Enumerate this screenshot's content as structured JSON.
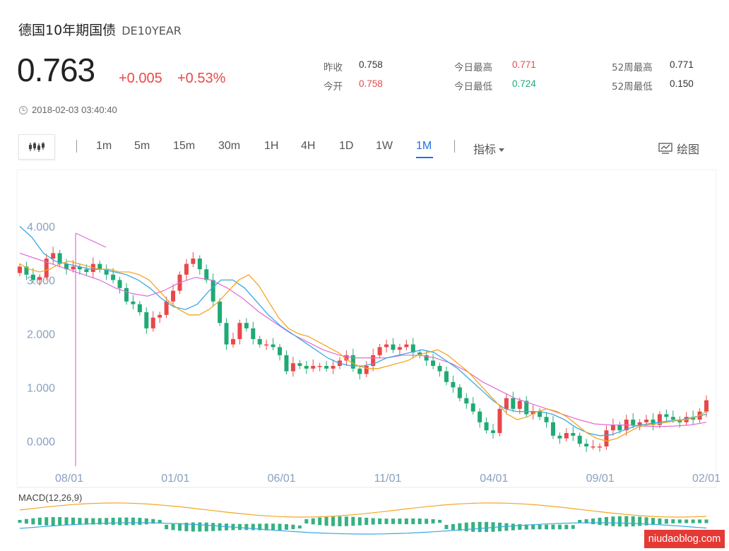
{
  "header": {
    "title": "德国10年期国债",
    "code": "DE10YEAR"
  },
  "quote": {
    "price": "0.763",
    "change": "+0.005",
    "change_pct": "+0.53%",
    "timestamp": "2018-02-03 03:40:40"
  },
  "stats": {
    "prev_close": {
      "label": "昨收",
      "value": "0.758"
    },
    "open": {
      "label": "今开",
      "value": "0.758"
    },
    "day_high": {
      "label": "今日最高",
      "value": "0.771"
    },
    "day_low": {
      "label": "今日最低",
      "value": "0.724"
    },
    "w52_high": {
      "label": "52周最高",
      "value": "0.771"
    },
    "w52_low": {
      "label": "52周最低",
      "value": "0.150"
    }
  },
  "toolbar": {
    "periods": [
      "1m",
      "5m",
      "15m",
      "30m",
      "1H",
      "4H",
      "1D",
      "1W",
      "1M"
    ],
    "active_period": "1M",
    "indicator_label": "指标",
    "draw_label": "绘图"
  },
  "colors": {
    "up": "#e8484a",
    "down": "#1faa74",
    "accent": "#1a73e8",
    "ma_orange": "#f5a623",
    "ma_blue": "#3ca8e0",
    "ma_pink": "#e26bd6"
  },
  "chart_data": {
    "type": "candlestick",
    "y_ticks": [
      "4.000",
      "3.000",
      "2.000",
      "1.000",
      "0.000"
    ],
    "ylim": [
      -0.6,
      4.4
    ],
    "x_ticks": [
      "08/01",
      "01/01",
      "06/01",
      "11/01",
      "04/01",
      "09/01",
      "02/01"
    ],
    "close": [
      3.25,
      3.1,
      3.0,
      3.05,
      3.4,
      3.5,
      3.3,
      3.2,
      3.25,
      3.2,
      3.15,
      3.3,
      3.2,
      3.1,
      3.0,
      2.85,
      2.6,
      2.55,
      2.4,
      2.1,
      2.3,
      2.35,
      2.6,
      2.8,
      3.1,
      3.3,
      3.4,
      3.2,
      3.0,
      2.6,
      2.2,
      1.8,
      1.9,
      2.2,
      2.1,
      1.9,
      1.8,
      1.8,
      1.75,
      1.6,
      1.3,
      1.45,
      1.4,
      1.35,
      1.4,
      1.4,
      1.35,
      1.4,
      1.5,
      1.6,
      1.35,
      1.25,
      1.4,
      1.6,
      1.75,
      1.8,
      1.7,
      1.75,
      1.8,
      1.65,
      1.6,
      1.5,
      1.4,
      1.3,
      1.1,
      1.0,
      0.8,
      0.7,
      0.55,
      0.35,
      0.2,
      0.15,
      0.6,
      0.8,
      0.6,
      0.75,
      0.5,
      0.55,
      0.45,
      0.35,
      0.1,
      0.05,
      0.15,
      0.1,
      -0.05,
      -0.1,
      -0.1,
      -0.1,
      0.2,
      0.3,
      0.2,
      0.4,
      0.3,
      0.35,
      0.4,
      0.3,
      0.5,
      0.45,
      0.4,
      0.35,
      0.45,
      0.4,
      0.55,
      0.76
    ],
    "ma_orange": [
      3.3,
      3.2,
      3.15,
      3.2,
      3.3,
      3.35,
      3.3,
      3.25,
      3.2,
      3.2,
      3.15,
      3.15,
      3.1,
      3.0,
      2.8,
      2.6,
      2.45,
      2.35,
      2.35,
      2.45,
      2.6,
      2.8,
      3.0,
      3.1,
      2.9,
      2.6,
      2.3,
      2.1,
      2.0,
      1.95,
      1.85,
      1.75,
      1.65,
      1.5,
      1.4,
      1.35,
      1.35,
      1.4,
      1.45,
      1.5,
      1.6,
      1.65,
      1.7,
      1.6,
      1.45,
      1.3,
      1.1,
      0.9,
      0.7,
      0.5,
      0.4,
      0.45,
      0.55,
      0.6,
      0.55,
      0.45,
      0.3,
      0.15,
      0.05,
      0.0,
      0.05,
      0.15,
      0.25,
      0.3,
      0.32,
      0.35,
      0.38,
      0.4,
      0.45,
      0.55
    ],
    "ma_blue": [
      4.0,
      3.8,
      3.5,
      3.35,
      3.3,
      3.25,
      3.2,
      3.2,
      3.15,
      3.1,
      3.0,
      2.85,
      2.65,
      2.5,
      2.45,
      2.55,
      2.8,
      3.0,
      3.0,
      2.85,
      2.6,
      2.35,
      2.15,
      2.0,
      1.85,
      1.7,
      1.55,
      1.45,
      1.4,
      1.4,
      1.45,
      1.55,
      1.6,
      1.65,
      1.7,
      1.65,
      1.5,
      1.35,
      1.15,
      0.95,
      0.75,
      0.6,
      0.55,
      0.55,
      0.55,
      0.5,
      0.4,
      0.25,
      0.15,
      0.1,
      0.12,
      0.2,
      0.28,
      0.32,
      0.35,
      0.38,
      0.4,
      0.45,
      0.5
    ],
    "ma_pink": [
      3.5,
      3.4,
      3.3,
      3.2,
      3.1,
      3.0,
      2.85,
      2.75,
      2.7,
      2.8,
      2.95,
      3.05,
      3.0,
      2.85,
      2.65,
      2.4,
      2.2,
      2.0,
      1.85,
      1.7,
      1.6,
      1.55,
      1.55,
      1.55,
      1.6,
      1.6,
      1.55,
      1.45,
      1.3,
      1.1,
      0.95,
      0.8,
      0.7,
      0.6,
      0.5,
      0.4,
      0.32,
      0.3,
      0.3,
      0.28,
      0.27,
      0.28,
      0.3,
      0.35
    ],
    "macd_label": "MACD(12,26,9)"
  },
  "watermark": "niudaoblog.com"
}
